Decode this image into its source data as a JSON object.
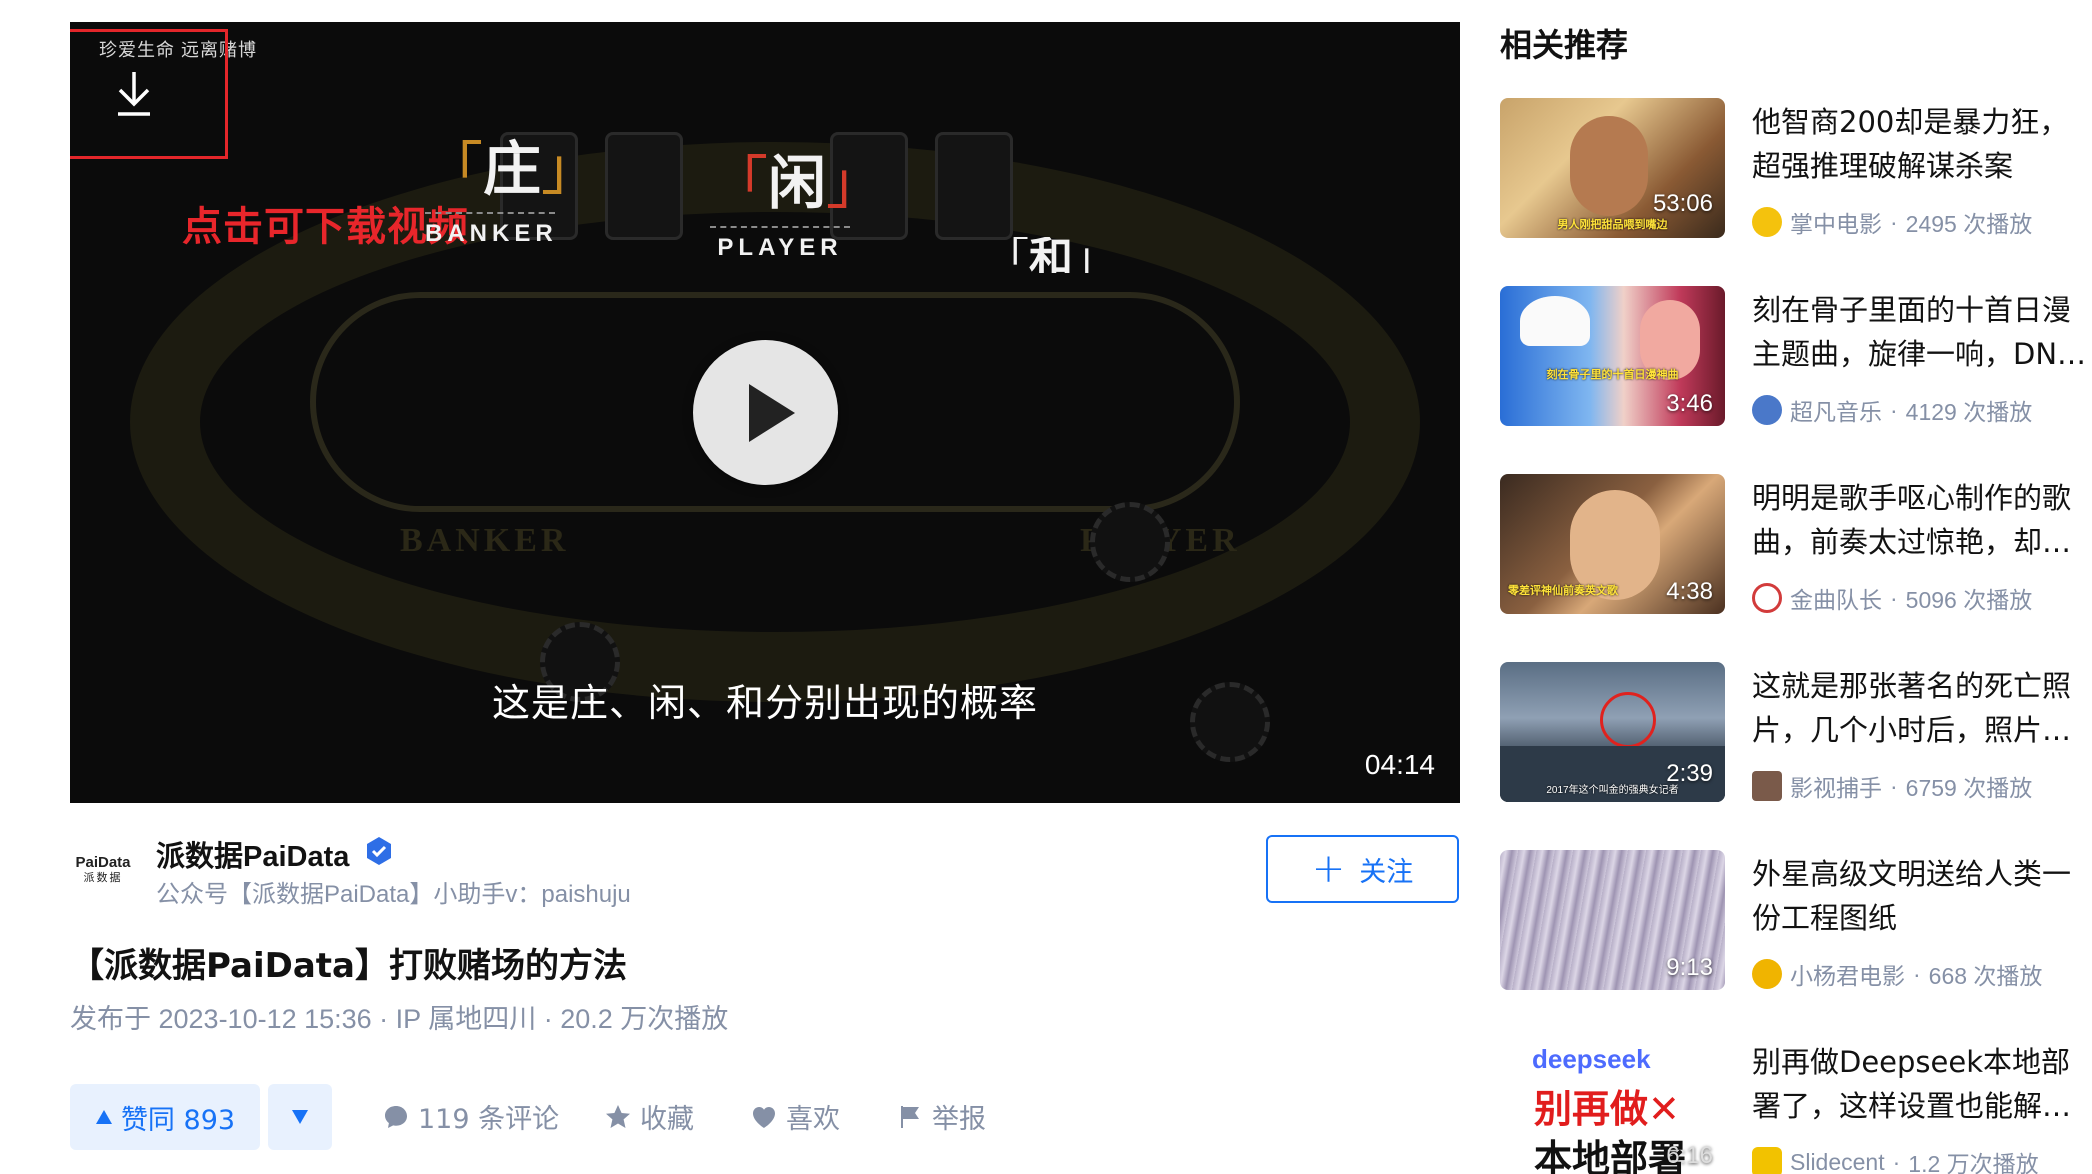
{
  "player": {
    "banner": "珍爱生命 远离赌博",
    "download_hint": "点击可下载视频",
    "roles": [
      {
        "zh": "庄",
        "en": "BANKER"
      },
      {
        "zh": "闲",
        "en": "PLAYER"
      },
      {
        "zh": "和",
        "en": ""
      }
    ],
    "subtitle": "这是庄、闲、和分别出现的概率",
    "duration": "04:14"
  },
  "author": {
    "logo_text": "PaiData",
    "logo_sub": "派数据",
    "name": "派数据PaiData",
    "description": "公众号【派数据PaiData】小助手v：paishuju",
    "follow_label": "关注"
  },
  "video": {
    "title": "【派数据PaiData】打败赌场的方法",
    "meta": "发布于 2023-10-12 15:36 · IP 属地四川 · 20.2 万次播放"
  },
  "actions": {
    "vote_up": "赞同 893",
    "comments": "119 条评论",
    "collect": "收藏",
    "like": "喜欢",
    "report": "举报"
  },
  "sidebar": {
    "title": "相关推荐",
    "items": [
      {
        "title": "他智商200却是暴力狂，超强推理破解谋杀案",
        "author": "掌中电影",
        "plays": "2495 次播放",
        "duration": "53:06",
        "caption": "男人刚把甜品喂到嘴边",
        "avatar_color": "#f4c20d"
      },
      {
        "title": "刻在骨子里面的十首日漫主题曲，旋律一响，DNA动了",
        "author": "超凡音乐",
        "plays": "4129 次播放",
        "duration": "3:46",
        "caption": "刻在骨子里的十首日漫神曲",
        "avatar_color": "#4a78c9"
      },
      {
        "title": "明明是歌手呕心制作的歌曲，前奏太过惊艳，却被当成BGM",
        "author": "金曲队长",
        "plays": "5096 次播放",
        "duration": "4:38",
        "caption": "零差评神仙前奏英文歌",
        "avatar_color": "#d23b3b"
      },
      {
        "title": "这就是那张著名的死亡照片，几个小时后，照片上的人",
        "author": "影视捕手",
        "plays": "6759 次播放",
        "duration": "2:39",
        "caption": "2017年这个叫金的强典女记者",
        "avatar_color": "#7a5a4a"
      },
      {
        "title": "外星高级文明送给人类一份工程图纸",
        "author": "小杨君电影",
        "plays": "668 次播放",
        "duration": "9:13",
        "caption": "",
        "avatar_color": "#f0b400"
      },
      {
        "title": "别再做Deepseek本地部署了，这样设置也能解决卡顿",
        "author": "Slidecent",
        "plays": "1.2 万次播放",
        "duration": "6:16",
        "caption": "",
        "avatar_color": "#f2c200",
        "thumb_logo": "deepseek",
        "thumb_line1": "别再做✕",
        "thumb_line2": "本地部署"
      }
    ]
  }
}
